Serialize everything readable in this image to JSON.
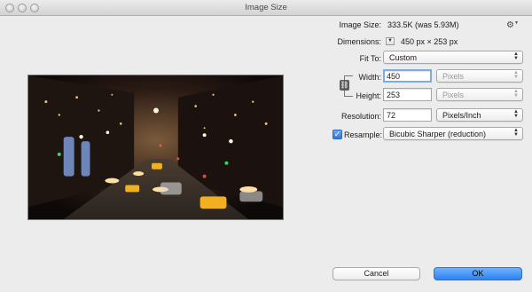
{
  "window": {
    "title": "Image Size"
  },
  "image_size": {
    "label": "Image Size:",
    "value": "333.5K (was 5.93M)"
  },
  "dimensions": {
    "label": "Dimensions:",
    "value": "450 px  ×  253 px"
  },
  "fit_to": {
    "label": "Fit To:",
    "selected": "Custom"
  },
  "width": {
    "label": "Width:",
    "value": "450",
    "unit": "Pixels"
  },
  "height": {
    "label": "Height:",
    "value": "253",
    "unit": "Pixels"
  },
  "resolution": {
    "label": "Resolution:",
    "value": "72",
    "unit": "Pixels/Inch"
  },
  "resample": {
    "label": "Resample:",
    "checked": true,
    "method": "Bicubic Sharper (reduction)"
  },
  "buttons": {
    "cancel": "Cancel",
    "ok": "OK"
  },
  "icons": {
    "window_controls": [
      "close-icon",
      "minimize-icon",
      "zoom-icon"
    ],
    "settings": "gear-icon",
    "dimensions_toggle": "disclosure-triangle-icon",
    "constrain_proportions": "chain-link-icon",
    "popup_arrows": "up-down-arrows-icon",
    "checkbox": "checkmark-icon"
  },
  "colors": {
    "ok_button": "#2d80f0",
    "checkbox": "#2f78d9",
    "focus_ring": "#7eabe3"
  }
}
